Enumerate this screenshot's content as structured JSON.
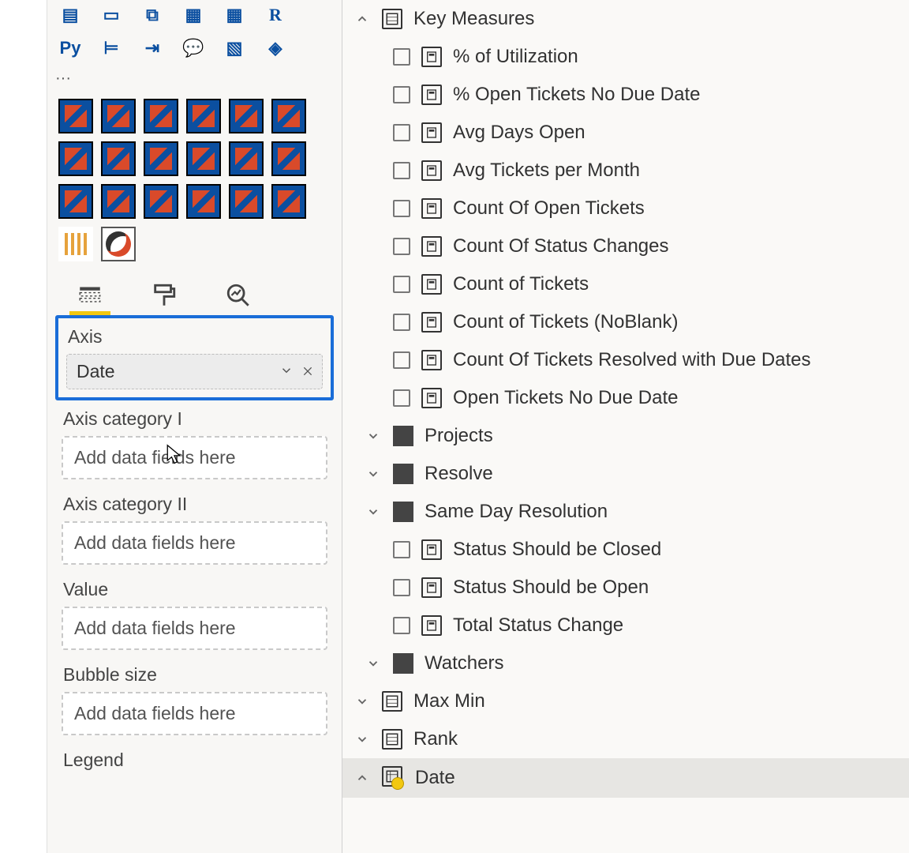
{
  "viz": {
    "python_label": "Py",
    "ellipsis": "···"
  },
  "wells": {
    "axis": {
      "label": "Axis",
      "value": "Date"
    },
    "axis_cat1": {
      "label": "Axis category I",
      "placeholder": "Add data fields here"
    },
    "axis_cat2": {
      "label": "Axis category II",
      "placeholder": "Add data fields here"
    },
    "value": {
      "label": "Value",
      "placeholder": "Add data fields here"
    },
    "bubble": {
      "label": "Bubble size",
      "placeholder": "Add data fields here"
    },
    "legend": {
      "label": "Legend"
    }
  },
  "fields": {
    "key_measures": {
      "label": "Key Measures",
      "items": [
        "% of Utilization",
        "% Open Tickets No Due Date",
        "Avg Days Open",
        "Avg Tickets per Month",
        "Count Of Open Tickets",
        "Count Of Status Changes",
        "Count of Tickets",
        "Count of Tickets (NoBlank)",
        "Count Of Tickets Resolved with Due Dates",
        "Open Tickets No Due Date"
      ]
    },
    "folders": [
      "Projects",
      "Resolve",
      "Same Day Resolution"
    ],
    "status_items": [
      "Status Should be Closed",
      "Status Should be Open",
      "Total Status Change"
    ],
    "watchers": "Watchers",
    "tables": [
      "Max Min",
      "Rank"
    ],
    "date_table": "Date"
  }
}
